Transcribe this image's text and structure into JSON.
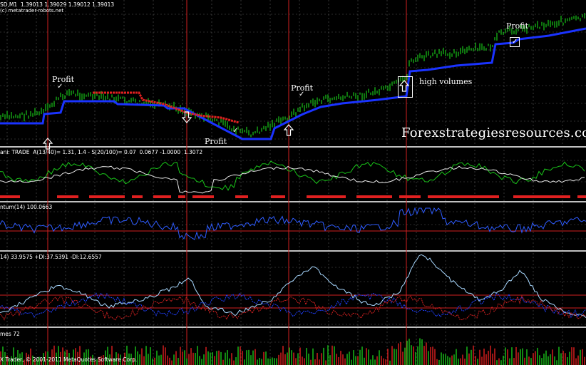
{
  "header": {
    "symbol_line": "SD,M1  1.39013 1.39029 1.39012 1.39013",
    "site": "(c) metatrader-robots.net"
  },
  "watermark": "Forexstrategiesresources.com",
  "annotations": {
    "profit_label": "Profit",
    "high_volumes": "high volumes",
    "check_glyph": "✓"
  },
  "indicators": {
    "trade_label": "ani: TRADE  A(13/40)= 1.31, 1.4 - S(20/100)= 0.07  0.0677 -1.0000  1.3072",
    "momentum_label": "ntum(14) 100.0663",
    "adx_label": "14) 33.9575 +DI:37.5391 -DI:12.6557",
    "volumes_label": "mes 72"
  },
  "footer": "X Trader, © 2001-2011 MetaQuotes Software Corp.",
  "colors": {
    "background": "#000000",
    "grid": "#5a5a5a",
    "separator": "#c0c0c0",
    "vline": "#d02020",
    "price": "#19c419",
    "support": "#1a33ff",
    "resistance": "#e02020",
    "white_line": "#e8e8e8",
    "momentum": "#2e5cff",
    "adx_main": "#a8d8ff",
    "plus_di": "#2040ff",
    "minus_di": "#d02020",
    "level": "#d02020"
  }
}
